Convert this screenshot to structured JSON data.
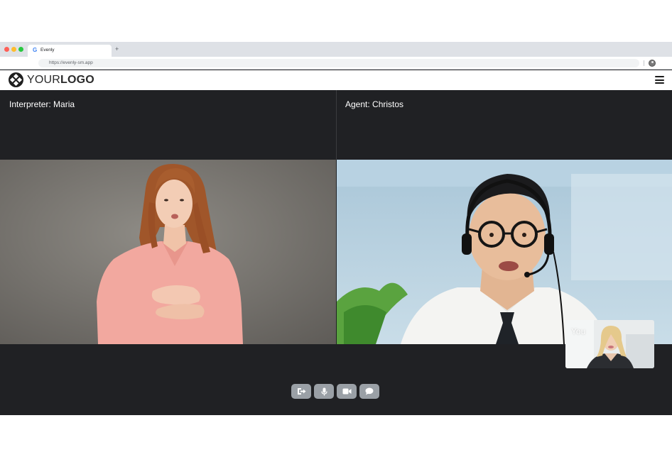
{
  "browser": {
    "tab_title": "Evenly",
    "tab_favicon": "G",
    "new_tab_symbol": "+",
    "url": "https://evenly-sm.app"
  },
  "app": {
    "logo_light": "YOUR",
    "logo_bold": "LOGO",
    "menu_icon": "hamburger-menu-icon"
  },
  "call": {
    "interpreter_label": "Interpreter: Maria",
    "agent_label": "Agent: Christos",
    "self_label": "You",
    "controls": [
      "leave-call-icon",
      "microphone-icon",
      "camera-icon",
      "chat-icon"
    ]
  },
  "colors": {
    "call_background": "#202124",
    "control_button": "#9aa0a6",
    "header_background": "#ffffff"
  }
}
